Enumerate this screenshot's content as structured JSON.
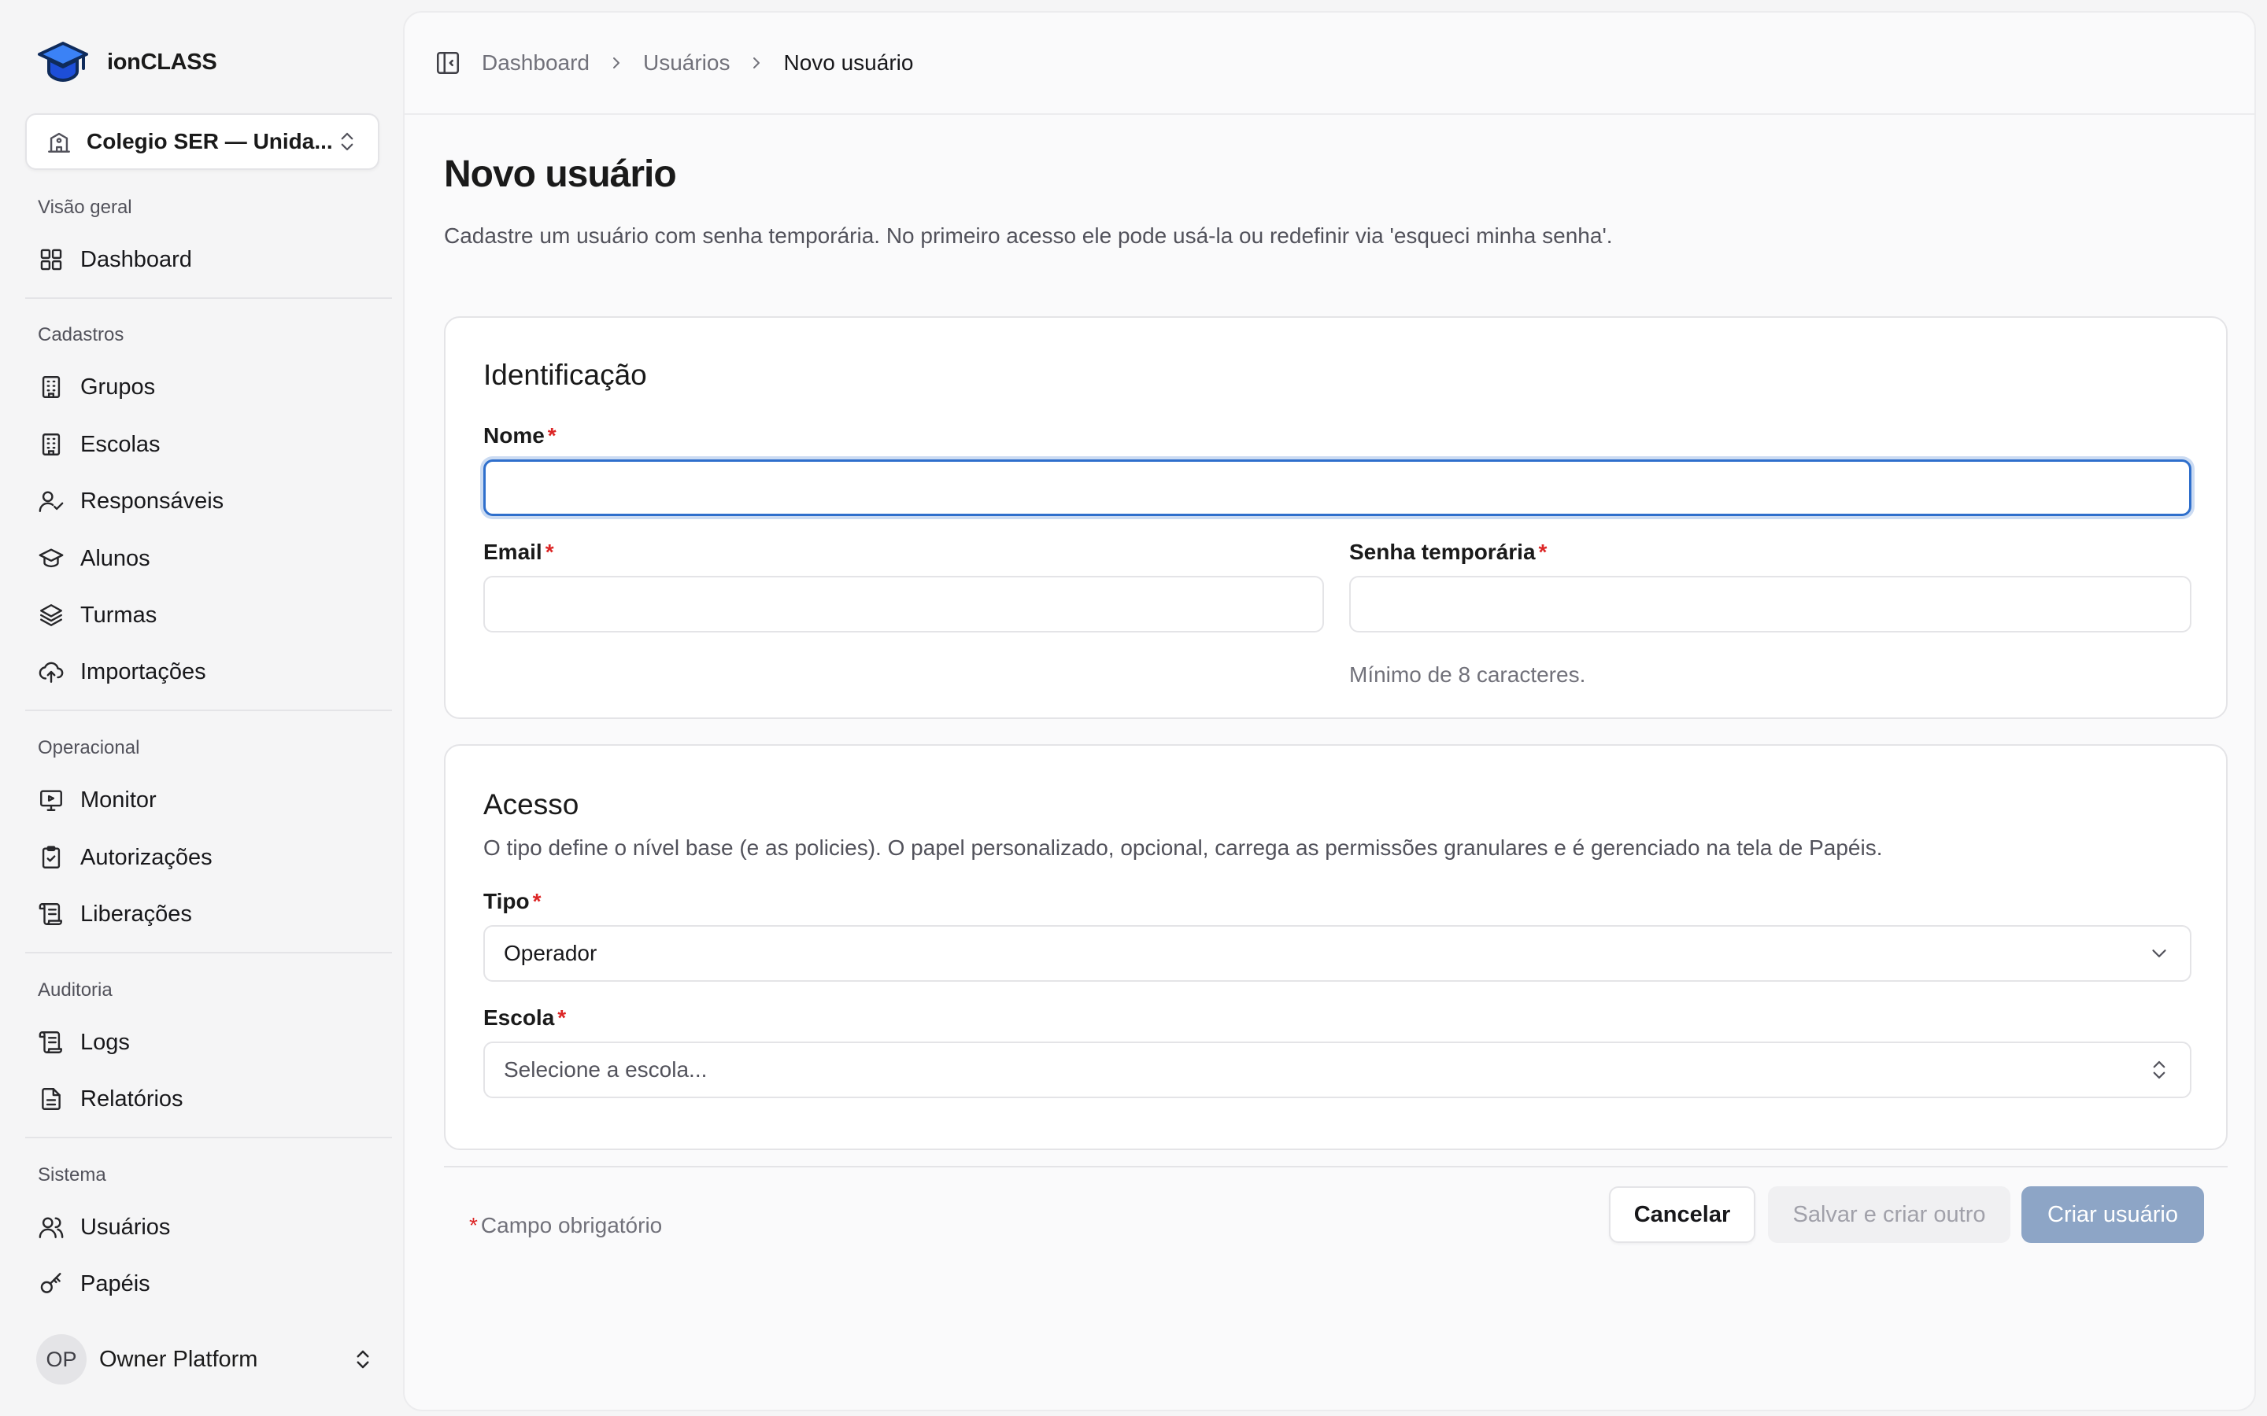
{
  "app": {
    "name": "ionCLASS"
  },
  "org_switcher": {
    "label": "Colegio SER — Unida..."
  },
  "nav": {
    "groups": [
      {
        "label": "Visão geral",
        "items": [
          {
            "label": "Dashboard",
            "icon": "grid-icon"
          }
        ]
      },
      {
        "label": "Cadastros",
        "items": [
          {
            "label": "Grupos",
            "icon": "building-icon"
          },
          {
            "label": "Escolas",
            "icon": "building-icon"
          },
          {
            "label": "Responsáveis",
            "icon": "user-check-icon"
          },
          {
            "label": "Alunos",
            "icon": "graduation-cap-icon"
          },
          {
            "label": "Turmas",
            "icon": "layers-icon"
          },
          {
            "label": "Importações",
            "icon": "cloud-upload-icon"
          }
        ]
      },
      {
        "label": "Operacional",
        "items": [
          {
            "label": "Monitor",
            "icon": "monitor-icon"
          },
          {
            "label": "Autorizações",
            "icon": "clipboard-check-icon"
          },
          {
            "label": "Liberações",
            "icon": "scroll-icon"
          }
        ]
      },
      {
        "label": "Auditoria",
        "items": [
          {
            "label": "Logs",
            "icon": "scroll-icon"
          },
          {
            "label": "Relatórios",
            "icon": "file-text-icon"
          }
        ]
      },
      {
        "label": "Sistema",
        "items": [
          {
            "label": "Usuários",
            "icon": "users-icon"
          },
          {
            "label": "Papéis",
            "icon": "key-icon"
          }
        ]
      }
    ]
  },
  "user": {
    "initials": "OP",
    "name": "Owner Platform"
  },
  "breadcrumb": {
    "items": [
      "Dashboard",
      "Usuários",
      "Novo usuário"
    ]
  },
  "page": {
    "title": "Novo usuário",
    "subtitle": "Cadastre um usuário com senha temporária. No primeiro acesso ele pode usá-la ou redefinir via 'esqueci minha senha'."
  },
  "identificacao": {
    "title": "Identificação",
    "nome_label": "Nome",
    "nome_value": "",
    "email_label": "Email",
    "email_value": "",
    "senha_label": "Senha temporária",
    "senha_value": "",
    "senha_hint": "Mínimo de 8 caracteres."
  },
  "acesso": {
    "title": "Acesso",
    "description": "O tipo define o nível base (e as policies). O papel personalizado, opcional, carrega as permissões granulares e é gerenciado na tela de Papéis.",
    "tipo_label": "Tipo",
    "tipo_value": "Operador",
    "escola_label": "Escola",
    "escola_placeholder": "Selecione a escola..."
  },
  "footer": {
    "required_mark": "*",
    "required_note": "Campo obrigatório",
    "cancel_label": "Cancelar",
    "save_another_label": "Salvar e criar outro",
    "create_label": "Criar usuário"
  },
  "colors": {
    "accent": "#2f6fcc",
    "primary_disabled": "#8da5c6",
    "required": "#dc2626"
  }
}
